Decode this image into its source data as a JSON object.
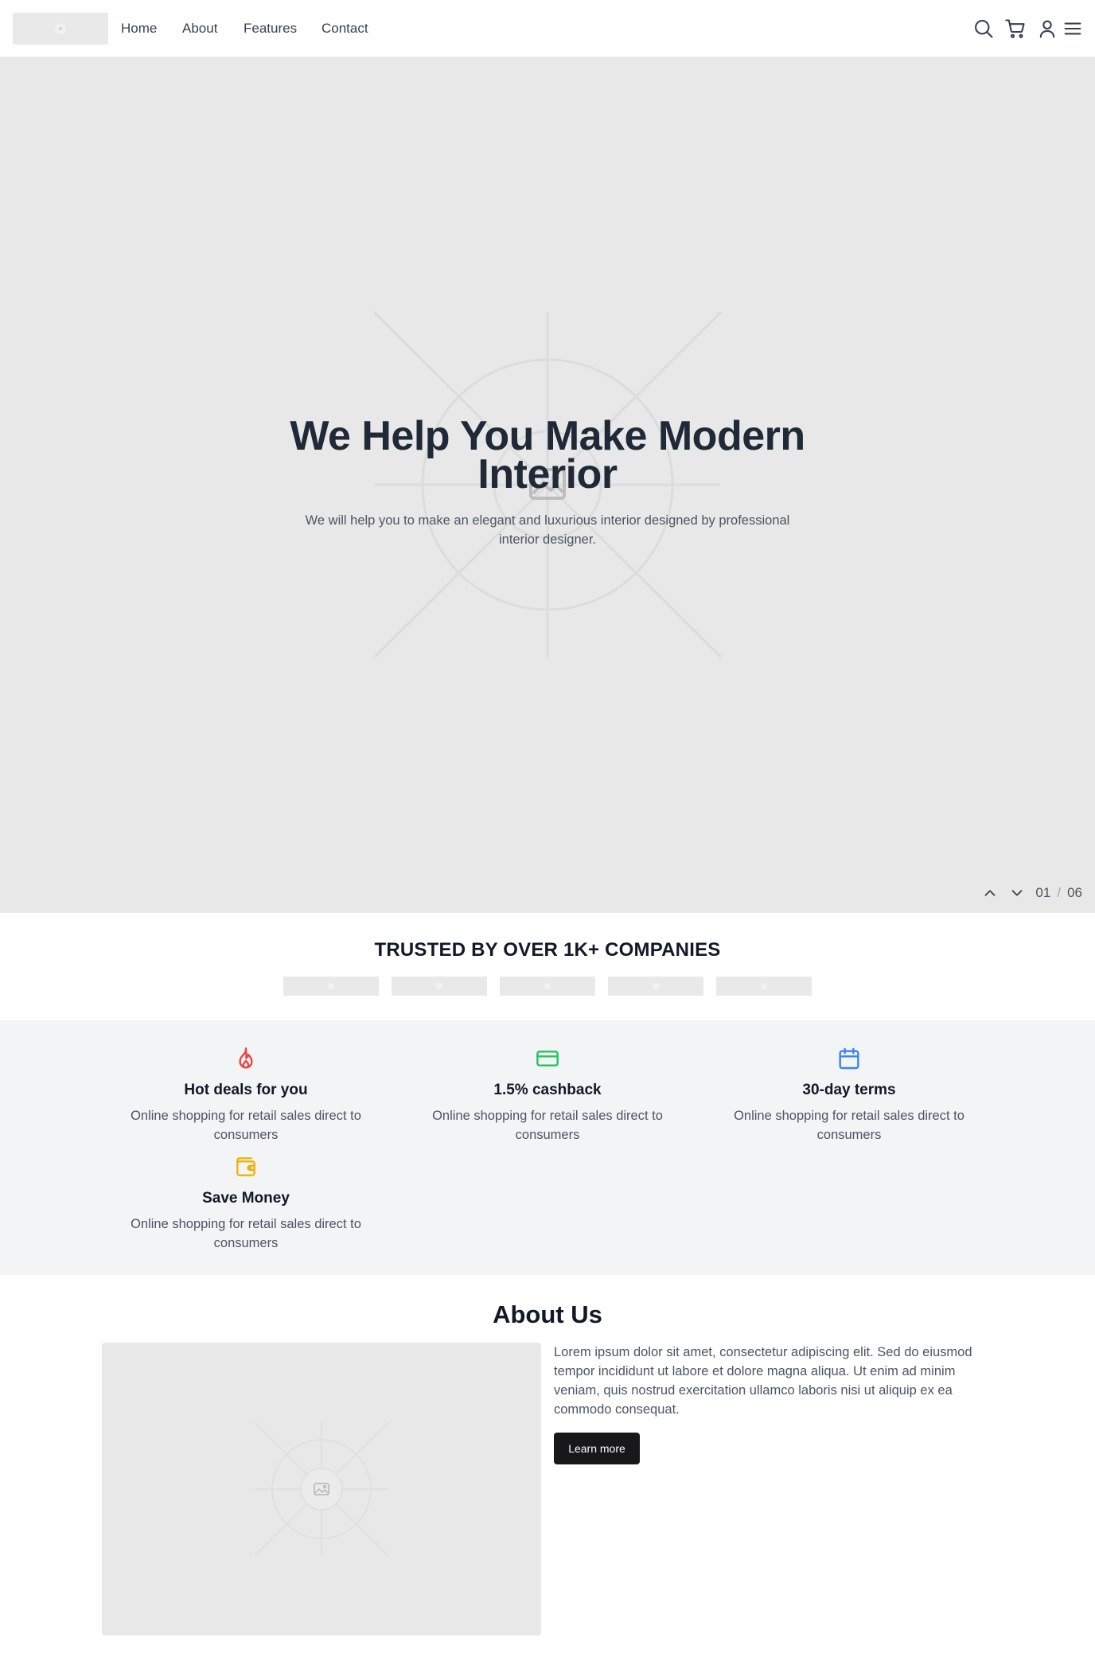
{
  "header": {
    "nav": [
      "Home",
      "About",
      "Features",
      "Contact"
    ],
    "icons": [
      "search-icon",
      "cart-icon",
      "user-icon",
      "menu-icon"
    ]
  },
  "hero": {
    "title": "We Help You Make Modern Interior",
    "subtitle": "We will help you to make an elegant and luxurious interior designed by professional interior designer.",
    "slide_current": "01",
    "slide_separator": "/",
    "slide_total": "06"
  },
  "trusted": {
    "title": "TRUSTED BY OVER 1K+ COMPANIES"
  },
  "features": [
    {
      "icon": "flame-icon",
      "color": "#ef4444",
      "title": "Hot deals for you",
      "desc": "Online shopping for retail sales direct to consumers"
    },
    {
      "icon": "credit-card-icon",
      "color": "#22c55e",
      "title": "1.5% cashback",
      "desc": "Online shopping for retail sales direct to consumers"
    },
    {
      "icon": "calendar-icon",
      "color": "#3b82f6",
      "title": "30-day terms",
      "desc": "Online shopping for retail sales direct to consumers"
    },
    {
      "icon": "wallet-icon",
      "color": "#eab308",
      "title": "Save Money",
      "desc": "Online shopping for retail sales direct to consumers"
    }
  ],
  "about": {
    "title": "About Us",
    "text": "Lorem ipsum dolor sit amet, consectetur adipiscing elit. Sed do eiusmod tempor incididunt ut labore et dolore magna aliqua. Ut enim ad minim veniam, quis nostrud exercitation ullamco laboris nisi ut aliquip ex ea commodo consequat.",
    "button": "Learn more"
  }
}
